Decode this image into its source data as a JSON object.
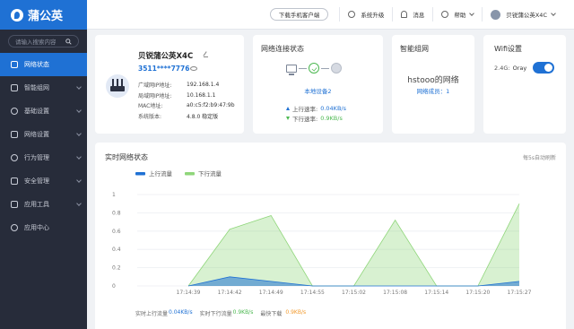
{
  "brand": {
    "name": "蒲公英"
  },
  "sidebar": {
    "search_placeholder": "请输入搜索内容",
    "items": [
      {
        "label": "网络状态",
        "icon": "monitor-icon",
        "active": true
      },
      {
        "label": "智能组网",
        "icon": "mesh-icon"
      },
      {
        "label": "基础设置",
        "icon": "settings-icon"
      },
      {
        "label": "网络设置",
        "icon": "network-icon"
      },
      {
        "label": "行为管理",
        "icon": "behavior-icon"
      },
      {
        "label": "安全管理",
        "icon": "shield-icon"
      },
      {
        "label": "应用工具",
        "icon": "toolbox-icon"
      },
      {
        "label": "应用中心",
        "icon": "app-center-icon"
      }
    ]
  },
  "topbar": {
    "download_client": "下载手机客户端",
    "upgrade": "系统升级",
    "messages": "消息",
    "help": "帮助",
    "user": "贝锐蒲公英X4C"
  },
  "device": {
    "name": "贝锐蒲公英X4C",
    "sn": "3511****7776",
    "info": [
      {
        "key": "广域网IP地址:",
        "value": "192.168.1.4"
      },
      {
        "key": "局域网IP地址:",
        "value": "10.168.1.1"
      },
      {
        "key": "MAC地址:",
        "value": "a0:c5:f2:b9:47:9b"
      },
      {
        "key": "系统版本:",
        "value": "4.8.0 稳定版"
      }
    ]
  },
  "network": {
    "title": "网络连接状态",
    "device": "本地设备2",
    "up_label": "上行速率:",
    "up_value": "0.04KB/s",
    "down_label": "下行速率:",
    "down_value": "0.9KB/s"
  },
  "mesh": {
    "title": "智能组网",
    "network_name": "hstooo的网络",
    "members": "网络成员：1"
  },
  "wifi": {
    "title": "Wifi设置",
    "band": "2.4G:",
    "ssid": "Oray",
    "enabled": true
  },
  "realtime": {
    "title": "实时网络状态",
    "note": "每5s自动刷新",
    "footer": {
      "up_label": "实时上行流量",
      "up_value": "0.04KB/s",
      "down_label": "实时下行流量",
      "down_value": "0.9KB/s",
      "peak_label": "最快下载",
      "peak_value": "0.9KB/s"
    }
  },
  "colors": {
    "accent": "#1f71d4",
    "up_series": "#1f71d4",
    "down_series": "#8fd67a",
    "sidebar": "#272c3a"
  },
  "chart_data": {
    "type": "area",
    "x": [
      "17:14:39",
      "17:14:42",
      "17:14:49",
      "17:14:55",
      "17:15:02",
      "17:15:08",
      "17:15:14",
      "17:15:20",
      "17:15:27"
    ],
    "series": [
      {
        "name": "上行流量",
        "color": "#1f71d4",
        "values": [
          0,
          0.1,
          0.05,
          0,
          0,
          0,
          0,
          0,
          0.05
        ]
      },
      {
        "name": "下行流量",
        "color": "#8fd67a",
        "values": [
          0,
          0.62,
          0.77,
          0,
          0,
          0.72,
          0,
          0,
          0.9
        ]
      }
    ],
    "ylim": [
      0,
      1
    ],
    "yticks": [
      0,
      0.2,
      0.4,
      0.6,
      0.8,
      1
    ],
    "legend": "top-left",
    "grid": true
  }
}
